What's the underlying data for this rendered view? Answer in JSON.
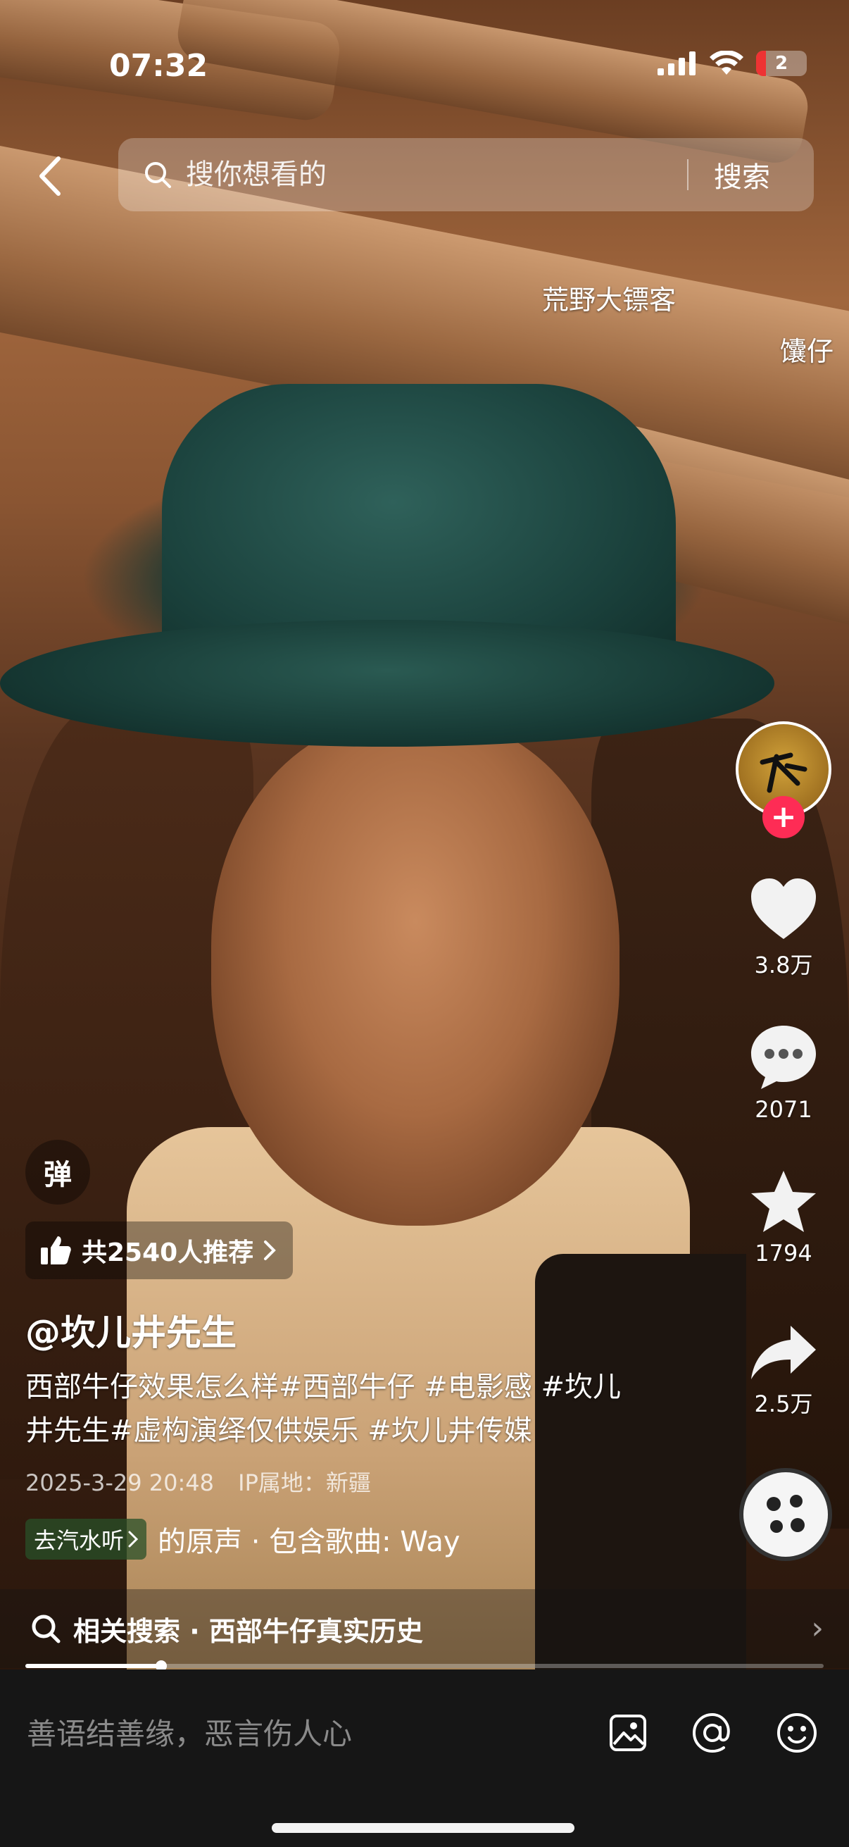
{
  "status_bar": {
    "time": "07:32",
    "battery_level": "2"
  },
  "search": {
    "placeholder": "搜你想看的",
    "button_label": "搜索"
  },
  "danmaku": [
    {
      "text": "荒野大镖客"
    },
    {
      "text": "馕仔"
    }
  ],
  "actions": {
    "like_count": "3.8万",
    "comment_count": "2071",
    "favorite_count": "1794",
    "share_count": "2.5万"
  },
  "overlay": {
    "danmaku_toggle": "弹",
    "recommend_text": "共2540人推荐",
    "username": "@坎儿井先生",
    "description": "西部牛仔效果怎么样#西部牛仔 #电影感 #坎儿井先生#虚构演绎仅供娱乐 #坎儿井传媒",
    "date": "2025-3-29 20:48",
    "ip_location": "IP属地：新疆",
    "soda_label": "去汽水听",
    "music_text": "的原声 · 包含歌曲: Way"
  },
  "related_search": {
    "label": "相关搜索 · 西部牛仔真实历史"
  },
  "video_progress": 0.17,
  "comment": {
    "placeholder": "善语结善缘，恶言伤人心"
  },
  "colors": {
    "accent": "#fe2c55",
    "soda_bg": "#2f5a2f"
  }
}
